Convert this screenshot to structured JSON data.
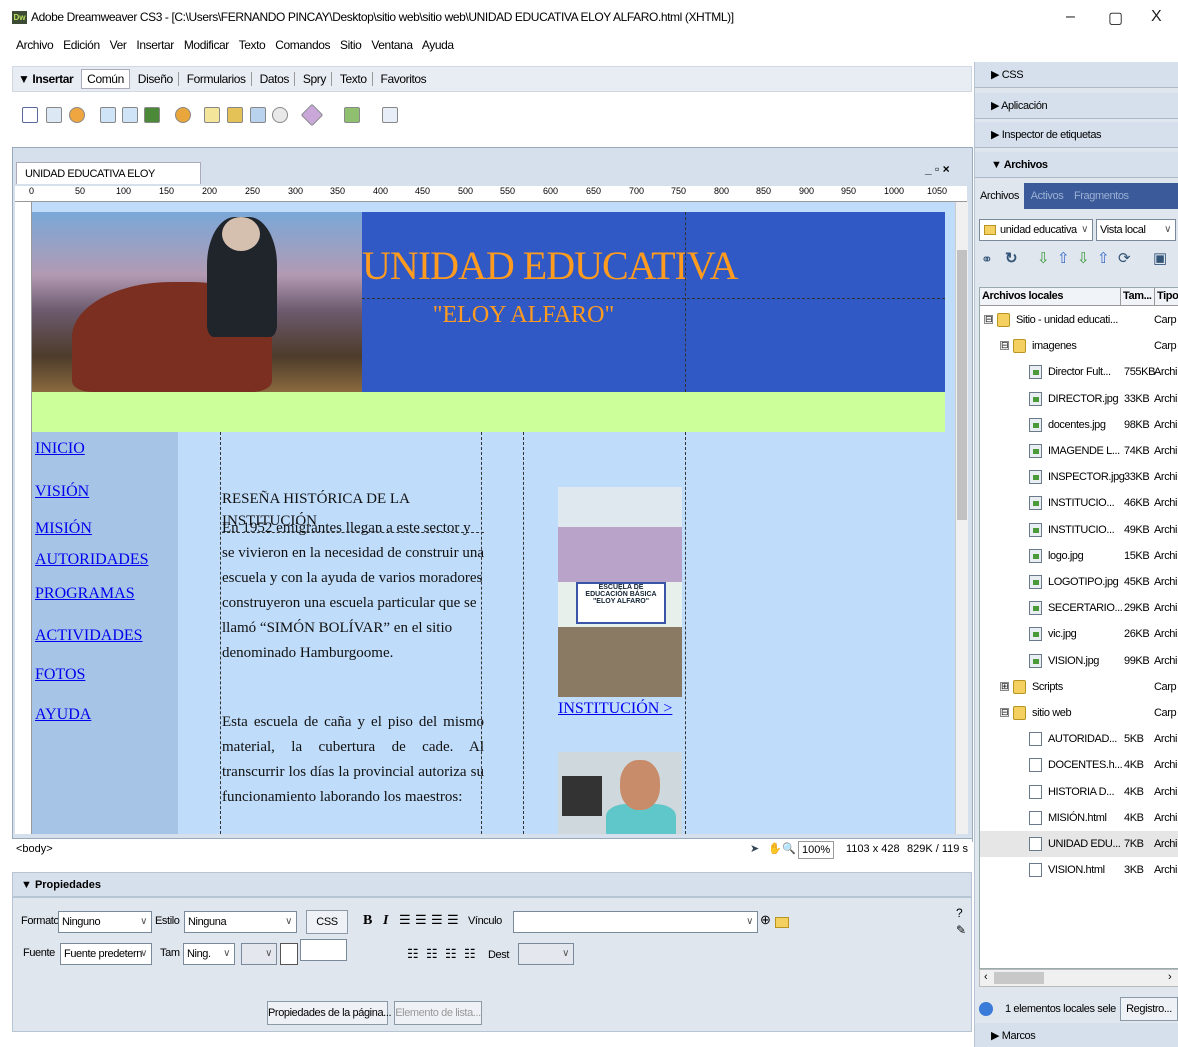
{
  "window": {
    "app_icon": "Dw",
    "title": "Adobe Dreamweaver CS3 - [C:\\Users\\FERNANDO PINCAY\\Desktop\\sitio web\\sitio web\\UNIDAD EDUCATIVA ELOY ALFARO.html (XHTML)]",
    "minimize": "–",
    "maximize": "▢",
    "close": "X"
  },
  "menu": [
    "Archivo",
    "Edición",
    "Ver",
    "Insertar",
    "Modificar",
    "Texto",
    "Comandos",
    "Sitio",
    "Ventana",
    "Ayuda"
  ],
  "insert": {
    "title": "▼ Insertar",
    "tabs": [
      "Común",
      "Diseño",
      "Formularios",
      "Datos",
      "Spry",
      "Texto",
      "Favoritos"
    ]
  },
  "document": {
    "tab": "UNIDAD EDUCATIVA ELOY ALFARO.html",
    "win_controls": "_ ▫ ×",
    "ruler": [
      "0",
      "50",
      "100",
      "150",
      "200",
      "250",
      "300",
      "350",
      "400",
      "450",
      "500",
      "550",
      "600",
      "650",
      "700",
      "750",
      "800",
      "850",
      "900",
      "950",
      "1000",
      "1050"
    ],
    "title": "UNIDAD EDUCATIVA",
    "subtitle": "\"ELOY ALFARO\"",
    "nav": [
      "INICIO",
      "VISIÓN",
      "MISIÓN",
      "AUTORIDADES",
      "PROGRAMAS",
      "ACTIVIDADES",
      "FOTOS",
      "AYUDA"
    ],
    "heading": "RESEÑA HISTÓRICA DE LA INSTITUCIÓN",
    "p1": "En 1952 emigrantes llegan a este sector y se vivieron en la necesidad de construir una escuela y con la ayuda de varios moradores construyeron una escuela particular que se llamó “SIMÓN BOLÍVAR” en el sitio denominado Hamburgoome.",
    "p2": "Esta escuela de caña y el piso del mismo material, la cubertura de cade. Al transcurrir los días la provincial autoriza su funcionamiento laborando los maestros:",
    "photo_banner": "ESCUELA DE EDUCACIÓN BÁSICA \"ELOY ALFARO\"",
    "inst_link": "INSTITUCIÓN >"
  },
  "status": {
    "tag": "<body>",
    "zoom": "100%",
    "size": "1103 x 428",
    "weight": "829K / 119 s"
  },
  "props": {
    "title": "▼ Propiedades",
    "formato_label": "Formato",
    "formato": "Ninguno",
    "estilo_label": "Estilo",
    "estilo": "Ninguna",
    "css": "CSS",
    "bold": "B",
    "italic": "I",
    "vinculo_label": "Vínculo",
    "fuente_label": "Fuente",
    "fuente": "Fuente predetern",
    "tam_label": "Tam",
    "tam": "Ning.",
    "dest_label": "Dest",
    "page_props": "Propiedades de la página...",
    "list_item": "Elemento de lista..."
  },
  "panel": {
    "css": "▶ CSS",
    "aplicacion": "▶ Aplicación",
    "inspector": "▶ Inspector de etiquetas",
    "archivos": "▼ Archivos",
    "tabs": [
      "Archivos",
      "Activos",
      "Fragmentos"
    ],
    "site": "unidad educativa",
    "view": "Vista local",
    "col_name": "Archivos locales",
    "col_size": "Tam...",
    "col_type": "Tipo",
    "files": [
      {
        "name": "Sitio - unidad educati...",
        "size": "",
        "type": "Carp",
        "indent": 0,
        "icon": "folder",
        "pm": "⊟"
      },
      {
        "name": "imagenes",
        "size": "",
        "type": "Carp",
        "indent": 1,
        "icon": "folder",
        "pm": "⊟"
      },
      {
        "name": "Director Fult...",
        "size": "755KB",
        "type": "Archi",
        "indent": 2,
        "icon": "img",
        "pm": ""
      },
      {
        "name": "DIRECTOR.jpg",
        "size": "33KB",
        "type": "Archi",
        "indent": 2,
        "icon": "img",
        "pm": ""
      },
      {
        "name": "docentes.jpg",
        "size": "98KB",
        "type": "Archi",
        "indent": 2,
        "icon": "img",
        "pm": ""
      },
      {
        "name": "IMAGENDE L...",
        "size": "74KB",
        "type": "Archi",
        "indent": 2,
        "icon": "img",
        "pm": ""
      },
      {
        "name": "INSPECTOR.jpg",
        "size": "33KB",
        "type": "Archi",
        "indent": 2,
        "icon": "img",
        "pm": ""
      },
      {
        "name": "INSTITUCIO...",
        "size": "46KB",
        "type": "Archi",
        "indent": 2,
        "icon": "img",
        "pm": ""
      },
      {
        "name": "INSTITUCIO...",
        "size": "49KB",
        "type": "Archi",
        "indent": 2,
        "icon": "img",
        "pm": ""
      },
      {
        "name": "logo.jpg",
        "size": "15KB",
        "type": "Archi",
        "indent": 2,
        "icon": "img",
        "pm": ""
      },
      {
        "name": "LOGOTIPO.jpg",
        "size": "45KB",
        "type": "Archi",
        "indent": 2,
        "icon": "img",
        "pm": ""
      },
      {
        "name": "SECERTARIO...",
        "size": "29KB",
        "type": "Archi",
        "indent": 2,
        "icon": "img",
        "pm": ""
      },
      {
        "name": "vic.jpg",
        "size": "26KB",
        "type": "Archi",
        "indent": 2,
        "icon": "img",
        "pm": ""
      },
      {
        "name": "VISION.jpg",
        "size": "99KB",
        "type": "Archi",
        "indent": 2,
        "icon": "img",
        "pm": ""
      },
      {
        "name": "Scripts",
        "size": "",
        "type": "Carp",
        "indent": 1,
        "icon": "folder",
        "pm": "⊞"
      },
      {
        "name": "sitio web",
        "size": "",
        "type": "Carp",
        "indent": 1,
        "icon": "folder",
        "pm": "⊟"
      },
      {
        "name": "AUTORIDAD...",
        "size": "5KB",
        "type": "Archi",
        "indent": 2,
        "icon": "pg",
        "pm": ""
      },
      {
        "name": "DOCENTES.h...",
        "size": "4KB",
        "type": "Archi",
        "indent": 2,
        "icon": "pg",
        "pm": ""
      },
      {
        "name": "HISTORIA D...",
        "size": "4KB",
        "type": "Archi",
        "indent": 2,
        "icon": "pg",
        "pm": ""
      },
      {
        "name": "MISIÓN.html",
        "size": "4KB",
        "type": "Archi",
        "indent": 2,
        "icon": "pg",
        "pm": ""
      },
      {
        "name": "UNIDAD EDU...",
        "size": "7KB",
        "type": "Archi",
        "indent": 2,
        "icon": "pg",
        "pm": ""
      },
      {
        "name": "VISION.html",
        "size": "3KB",
        "type": "Archi",
        "indent": 2,
        "icon": "pg",
        "pm": ""
      }
    ],
    "status": "1 elementos locales sele",
    "registro": "Registro...",
    "marcos": "▶ Marcos"
  }
}
